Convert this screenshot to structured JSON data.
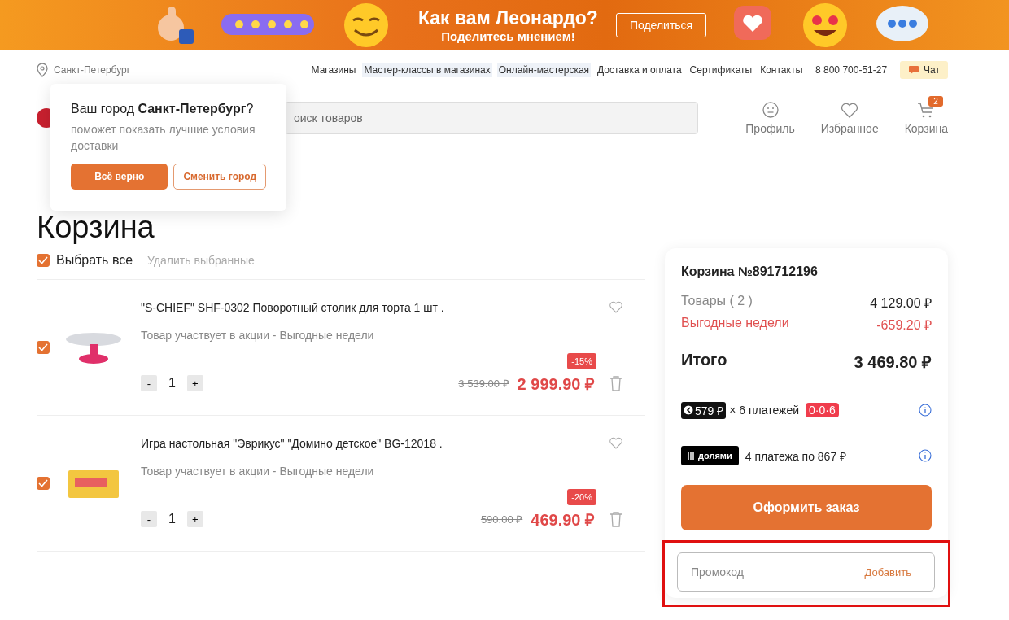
{
  "banner": {
    "title": "Как вам Леонардо?",
    "subtitle": "Поделитесь мнением!",
    "button": "Поделиться"
  },
  "topbar": {
    "city": "Санкт-Петербург",
    "links": [
      {
        "label": "Магазины",
        "highlighted": false
      },
      {
        "label": "Мастер-классы в магазинах",
        "highlighted": true
      },
      {
        "label": "Онлайн-мастерская",
        "highlighted": true
      },
      {
        "label": "Доставка и оплата",
        "highlighted": false
      },
      {
        "label": "Сертификаты",
        "highlighted": false
      },
      {
        "label": "Контакты",
        "highlighted": false
      }
    ],
    "phone": "8 800 700-51-27",
    "chat": "Чат"
  },
  "header": {
    "search": {
      "placeholder": "оиск товаров"
    },
    "actions": [
      {
        "kind": "profile",
        "label": "Профиль"
      },
      {
        "kind": "favorites",
        "label": "Избранное"
      },
      {
        "kind": "cart",
        "label": "Корзина",
        "badge": "2"
      }
    ]
  },
  "city_popup": {
    "question_prefix": "Ваш город ",
    "city": "Санкт-Петербург",
    "question_suffix": "?",
    "hint": "поможет показать лучшие условия доставки",
    "confirm": "Всё верно",
    "change": "Сменить город"
  },
  "page_title": "Корзина",
  "select_all": {
    "label": "Выбрать все",
    "checked": true,
    "delete": "Удалить выбранные"
  },
  "items": [
    {
      "kind": "turntable",
      "title": "\"S-CHIEF\" SHF-0302 Поворотный столик для торта 1 шт .",
      "promo": "Товар участвует в акции - Выгодные недели",
      "checked": true,
      "quantity": "1",
      "minus": "-",
      "plus": "+",
      "discount": "-15%",
      "old_price": "3 539.00 ₽",
      "price": "2 999.90 ₽"
    },
    {
      "kind": "boardgame",
      "title": "Игра настольная \"Эврикус\" \"Домино детское\" BG-12018 .",
      "promo": "Товар участвует в акции - Выгодные недели",
      "checked": true,
      "quantity": "1",
      "minus": "-",
      "plus": "+",
      "discount": "-20%",
      "old_price": "590.00 ₽",
      "price": "469.90 ₽"
    }
  ],
  "summary": {
    "title": "Корзина №891712196",
    "lines": [
      {
        "kind": "normal",
        "label": "Товары ( 2 )",
        "value": "4 129.00 ₽"
      },
      {
        "kind": "discount",
        "label": "Выгодные недели",
        "value": "-659.20 ₽"
      }
    ],
    "total_label": "Итого",
    "total": "3 469.80 ₽",
    "installments": [
      {
        "kind": "split",
        "badge": "579 ₽",
        "text": "× 6 платежей",
        "tag": "0·0·6"
      },
      {
        "kind": "dolyami",
        "badge": "долями",
        "text": "4 платежа по 867 ₽"
      }
    ],
    "checkout": "Оформить заказ",
    "promo": {
      "placeholder": "Промокод",
      "button": "Добавить",
      "highlighted": true
    }
  }
}
